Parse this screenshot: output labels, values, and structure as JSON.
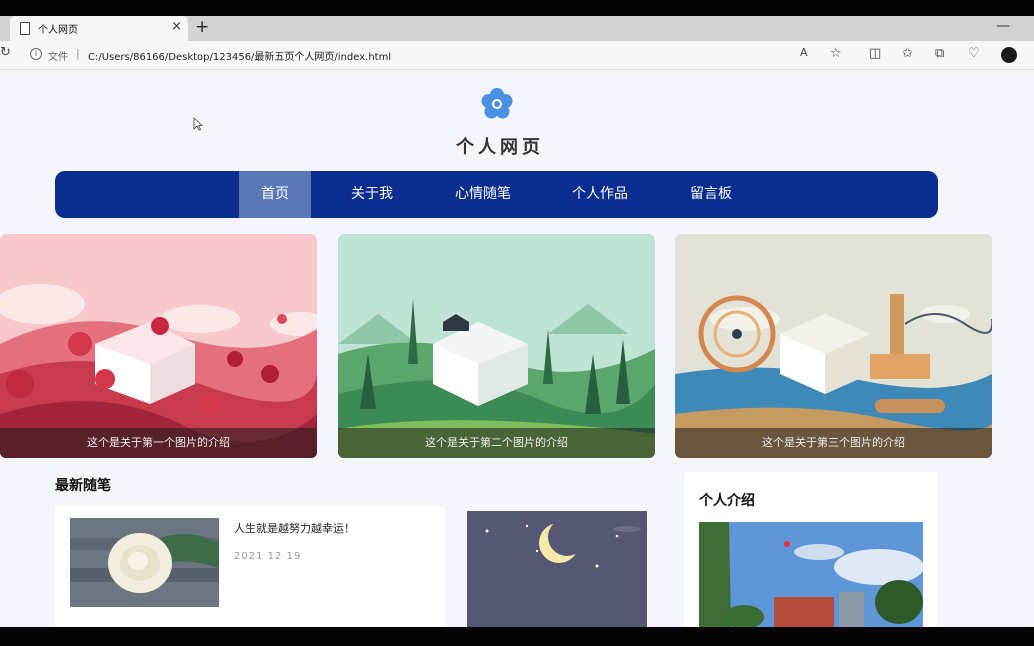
{
  "browser": {
    "tab_title": "个人网页",
    "tab_close": "×",
    "new_tab": "+",
    "minimize": "—",
    "address_file_label": "文件",
    "address_separator": "|",
    "url": "C:/Users/86166/Desktop/123456/最新五页个人网页/index.html"
  },
  "site": {
    "title": "个人网页"
  },
  "nav": {
    "items": [
      {
        "label": "首页",
        "active": true
      },
      {
        "label": "关于我"
      },
      {
        "label": "心情随笔"
      },
      {
        "label": "个人作品"
      },
      {
        "label": "留言板"
      }
    ]
  },
  "banner": {
    "cards": [
      {
        "caption": "这个是关于第一个图片的介绍"
      },
      {
        "caption": "这个是关于第二个图片的介绍"
      },
      {
        "caption": "这个是关于第三个图片的介绍"
      }
    ]
  },
  "latest": {
    "title": "最新随笔",
    "post": {
      "text": "人生就是越努力越幸运！",
      "date": "2021 12 19"
    }
  },
  "intro": {
    "title": "个人介绍"
  },
  "colors": {
    "nav_bg": "#0a2d8f",
    "nav_active": "#5b77b6",
    "page_bg": "#f4f6fc",
    "logo": "#4a90e2"
  }
}
